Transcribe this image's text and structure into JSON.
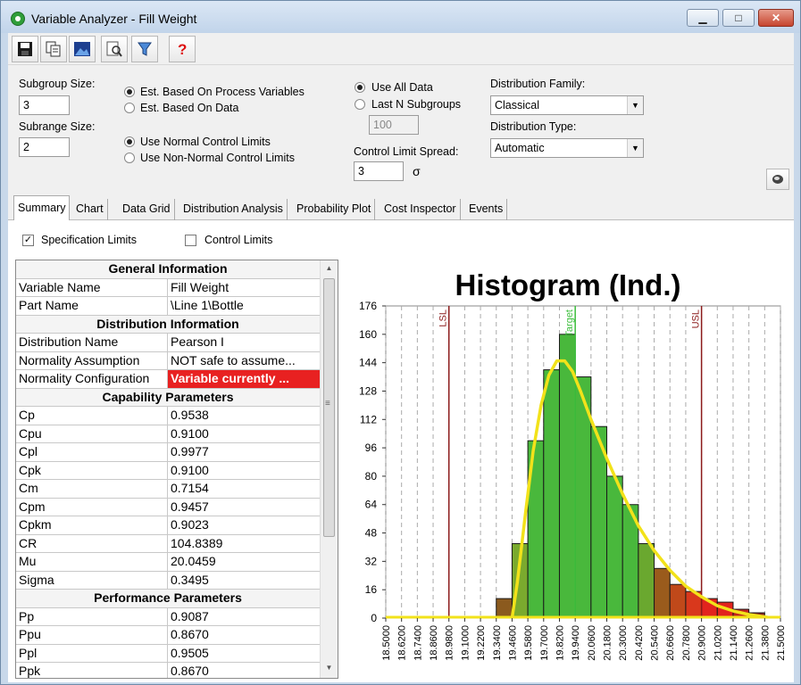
{
  "window": {
    "title": "Variable Analyzer - Fill Weight",
    "min": "▁",
    "max": "□",
    "close": "✕"
  },
  "toolbar": [
    {
      "name": "save-icon",
      "glyph": "💾"
    },
    {
      "name": "copy-icon",
      "glyph": "⧉"
    },
    {
      "name": "image-icon",
      "glyph": "▦"
    },
    {
      "name": "preview-icon",
      "glyph": "🔍"
    },
    {
      "name": "filter-icon",
      "glyph": "⏷"
    },
    {
      "name": "help-icon",
      "glyph": "?"
    }
  ],
  "settings": {
    "subgroup_label": "Subgroup Size:",
    "subgroup_value": "3",
    "subrange_label": "Subrange Size:",
    "subrange_value": "2",
    "est_process": "Est. Based On Process Variables",
    "est_data": "Est. Based On Data",
    "normal_limits": "Use Normal Control Limits",
    "nonnormal_limits": "Use Non-Normal Control Limits",
    "use_all": "Use All Data",
    "last_n": "Last N Subgroups",
    "last_n_value": "100",
    "spread_label": "Control Limit Spread:",
    "spread_value": "3",
    "sigma": "σ",
    "family_label": "Distribution Family:",
    "family_value": "Classical",
    "type_label": "Distribution Type:",
    "type_value": "Automatic"
  },
  "tabs": [
    "Summary",
    "Chart",
    "Data Grid",
    "Distribution Analysis",
    "Probability Plot",
    "Cost Inspector",
    "Events"
  ],
  "options": {
    "spec_limits": "Specification Limits",
    "spec_checked": "✓",
    "control_limits": "Control Limits"
  },
  "grid": [
    {
      "h": "General Information"
    },
    {
      "k": "Variable Name",
      "v": "Fill Weight"
    },
    {
      "k": "Part Name",
      "v": "\\Line 1\\Bottle"
    },
    {
      "h": "Distribution Information"
    },
    {
      "k": "Distribution Name",
      "v": "Pearson I"
    },
    {
      "k": "Normality Assumption",
      "v": "NOT safe to assume..."
    },
    {
      "k": "Normality Configuration",
      "v": "Variable currently ...",
      "red": true
    },
    {
      "h": "Capability Parameters"
    },
    {
      "k": "Cp",
      "v": "0.9538"
    },
    {
      "k": "Cpu",
      "v": "0.9100"
    },
    {
      "k": "Cpl",
      "v": "0.9977"
    },
    {
      "k": "Cpk",
      "v": "0.9100"
    },
    {
      "k": "Cm",
      "v": "0.7154"
    },
    {
      "k": "Cpm",
      "v": "0.9457"
    },
    {
      "k": "Cpkm",
      "v": "0.9023"
    },
    {
      "k": "CR",
      "v": "104.8389"
    },
    {
      "k": "Mu",
      "v": "20.0459"
    },
    {
      "k": "Sigma",
      "v": "0.3495"
    },
    {
      "h": "Performance Parameters"
    },
    {
      "k": "Pp",
      "v": "0.9087"
    },
    {
      "k": "Ppu",
      "v": "0.8670"
    },
    {
      "k": "Ppl",
      "v": "0.9505"
    },
    {
      "k": "Ppk",
      "v": "0.8670"
    }
  ],
  "scroll": {
    "up": "▲",
    "down": "▼",
    "grip": "≡"
  },
  "chart_data": {
    "type": "bar",
    "title": "Histogram (Ind.)",
    "ylim": [
      0,
      176
    ],
    "yticks": [
      "0",
      "16",
      "32",
      "48",
      "64",
      "80",
      "96",
      "112",
      "128",
      "144",
      "160",
      "176"
    ],
    "xticks": [
      "18.5000",
      "18.6200",
      "18.7400",
      "18.8600",
      "18.9800",
      "19.1000",
      "19.2200",
      "19.3400",
      "19.4600",
      "19.5800",
      "19.7000",
      "19.8200",
      "19.9400",
      "20.0600",
      "20.1800",
      "20.3000",
      "20.4200",
      "20.5400",
      "20.6600",
      "20.7800",
      "20.9000",
      "21.0200",
      "21.1400",
      "21.2600",
      "21.3800",
      "21.5000"
    ],
    "xlim": [
      18.5,
      21.5
    ],
    "bins": [
      {
        "x0": 19.34,
        "x1": 19.46,
        "v": 11,
        "c": "#8b5a1e"
      },
      {
        "x0": 19.46,
        "x1": 19.58,
        "v": 42,
        "c": "#7aaa2e"
      },
      {
        "x0": 19.58,
        "x1": 19.7,
        "v": 100,
        "c": "#49b83c"
      },
      {
        "x0": 19.7,
        "x1": 19.82,
        "v": 140,
        "c": "#49b83c"
      },
      {
        "x0": 19.82,
        "x1": 19.94,
        "v": 160,
        "c": "#49b83c"
      },
      {
        "x0": 19.94,
        "x1": 20.06,
        "v": 136,
        "c": "#49b83c"
      },
      {
        "x0": 20.06,
        "x1": 20.18,
        "v": 108,
        "c": "#49b83c"
      },
      {
        "x0": 20.18,
        "x1": 20.3,
        "v": 80,
        "c": "#49b83c"
      },
      {
        "x0": 20.3,
        "x1": 20.42,
        "v": 64,
        "c": "#49b83c"
      },
      {
        "x0": 20.42,
        "x1": 20.54,
        "v": 42,
        "c": "#6aa82f"
      },
      {
        "x0": 20.54,
        "x1": 20.66,
        "v": 28,
        "c": "#9a5b1c"
      },
      {
        "x0": 20.66,
        "x1": 20.78,
        "v": 19,
        "c": "#c0491a"
      },
      {
        "x0": 20.78,
        "x1": 20.9,
        "v": 15,
        "c": "#d9381c"
      },
      {
        "x0": 20.9,
        "x1": 21.02,
        "v": 11,
        "c": "#e2241e"
      },
      {
        "x0": 21.02,
        "x1": 21.14,
        "v": 9,
        "c": "#e2241e"
      },
      {
        "x0": 21.14,
        "x1": 21.26,
        "v": 5,
        "c": "#c0241e"
      },
      {
        "x0": 21.26,
        "x1": 21.38,
        "v": 3,
        "c": "#8b241e"
      }
    ],
    "curve": [
      [
        19.46,
        0
      ],
      [
        19.5,
        20
      ],
      [
        19.56,
        58
      ],
      [
        19.62,
        94
      ],
      [
        19.68,
        120
      ],
      [
        19.74,
        137
      ],
      [
        19.8,
        145
      ],
      [
        19.86,
        145
      ],
      [
        19.92,
        139
      ],
      [
        19.98,
        128
      ],
      [
        20.06,
        112
      ],
      [
        20.18,
        90
      ],
      [
        20.3,
        70
      ],
      [
        20.42,
        52
      ],
      [
        20.54,
        38
      ],
      [
        20.66,
        27
      ],
      [
        20.78,
        18
      ],
      [
        20.9,
        12
      ],
      [
        21.02,
        7
      ],
      [
        21.14,
        4
      ],
      [
        21.26,
        2
      ],
      [
        21.4,
        0.5
      ]
    ],
    "lines": [
      {
        "x": 18.98,
        "label": "LSL",
        "color": "#8b1a1a"
      },
      {
        "x": 19.94,
        "label": "Target",
        "color": "#3cbf3c"
      },
      {
        "x": 20.9,
        "label": "USL",
        "color": "#8b1a1a"
      }
    ],
    "colors": {
      "curve": "#f2e21a",
      "grid": "#aaaaaa"
    }
  }
}
